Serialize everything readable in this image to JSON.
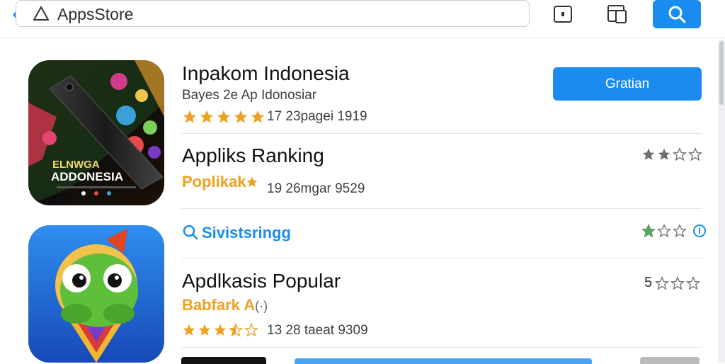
{
  "search": {
    "query": "AppsStore"
  },
  "toolbar": {
    "tool1_icon": "square-dot-icon",
    "tool2_icon": "split-window-icon",
    "search_icon": "search-icon"
  },
  "apps": [
    {
      "title": "Inpakom Indonesia",
      "subtitle": "Bayes 2e   Ap Idonosiar",
      "rating_fraction": 1.0,
      "meta": "17 23pagei 1919",
      "action_label": "Gratian",
      "icon_text": "ELNWGA\nADDONESIA"
    }
  ],
  "sections": [
    {
      "title": "Appliks Ranking",
      "tag": "Poplikak",
      "meta": "19 26mgar 9529",
      "right_rating_fraction": 0.5
    },
    {
      "link": "Sivistsringg",
      "right_rating_fraction": 0.33
    },
    {
      "title": "Apdlkasis Popular",
      "tag": "Babfark A",
      "meta": "13 28 taeat 9309",
      "left_rating_fraction": 0.7,
      "right_lead": "5",
      "right_rating_fraction": 0.0
    }
  ],
  "colors": {
    "accent": "#1a8cf0",
    "star_gold": "#f0a020",
    "star_gray": "#6e6e6e",
    "star_green": "#4caf50"
  }
}
